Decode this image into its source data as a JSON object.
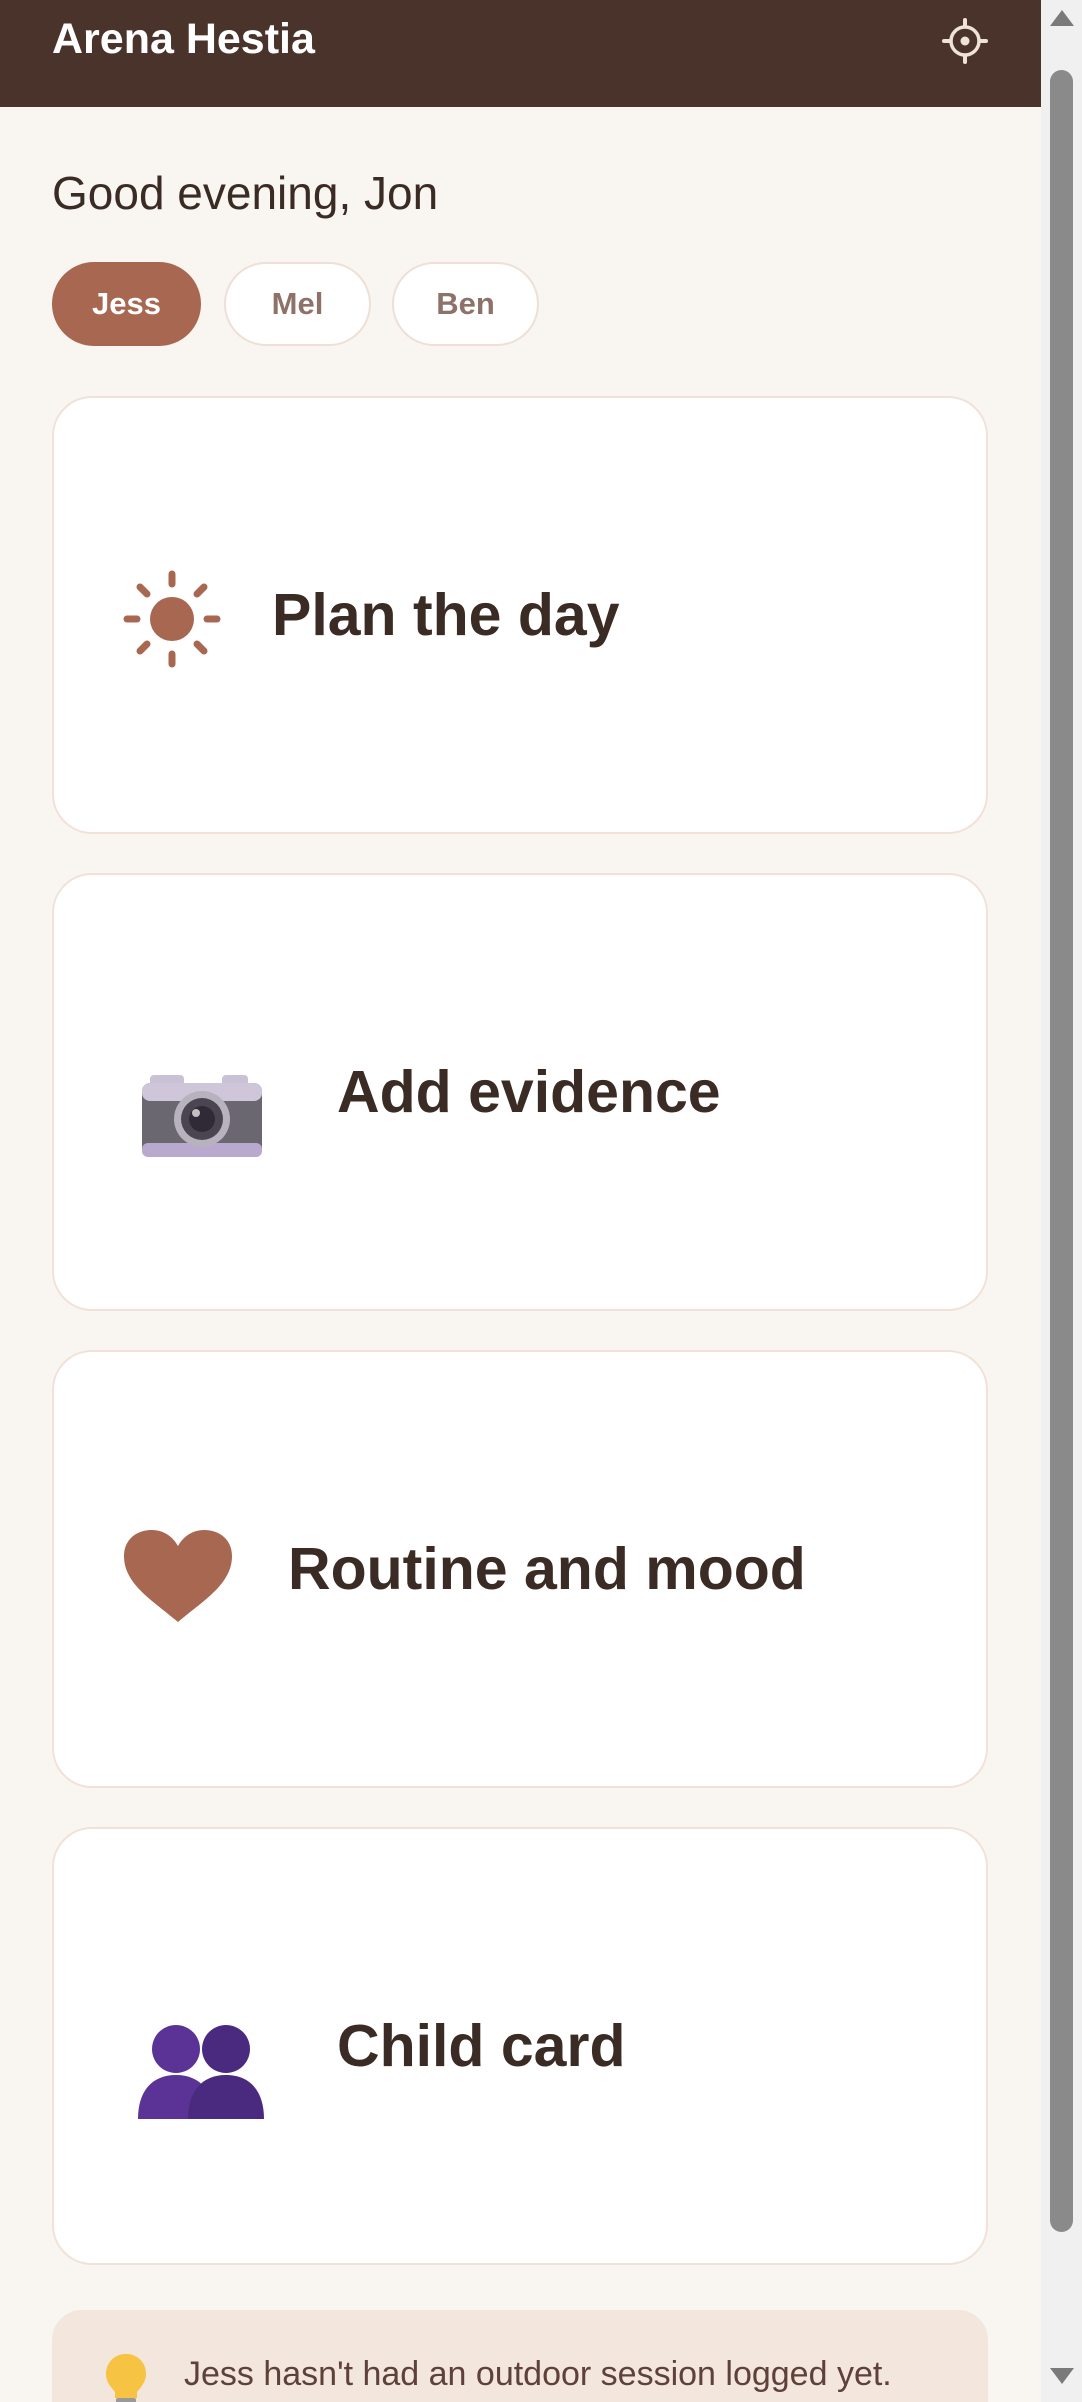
{
  "app": {
    "title": "Arena Hestia",
    "settings_icon": "settings-gear-icon"
  },
  "greeting": "Good evening, Jon",
  "children": [
    {
      "label": "Jess",
      "selected": true
    },
    {
      "label": "Mel",
      "selected": false
    },
    {
      "label": "Ben",
      "selected": false
    }
  ],
  "cards": [
    {
      "label": "Plan the day",
      "icon": "sun-icon"
    },
    {
      "label": "Add evidence",
      "icon": "camera-icon"
    },
    {
      "label": "Routine and mood",
      "icon": "heart-icon"
    },
    {
      "label": "Child card",
      "icon": "people-icon"
    }
  ],
  "tip": {
    "icon": "lightbulb-icon",
    "text": "Jess hasn't had an outdoor session logged yet."
  },
  "colors": {
    "header": "#4a332b",
    "accent": "#a86751",
    "background": "#f9f5f1",
    "card_border": "#f2e1d8",
    "tip_background": "#f3e6dd"
  }
}
